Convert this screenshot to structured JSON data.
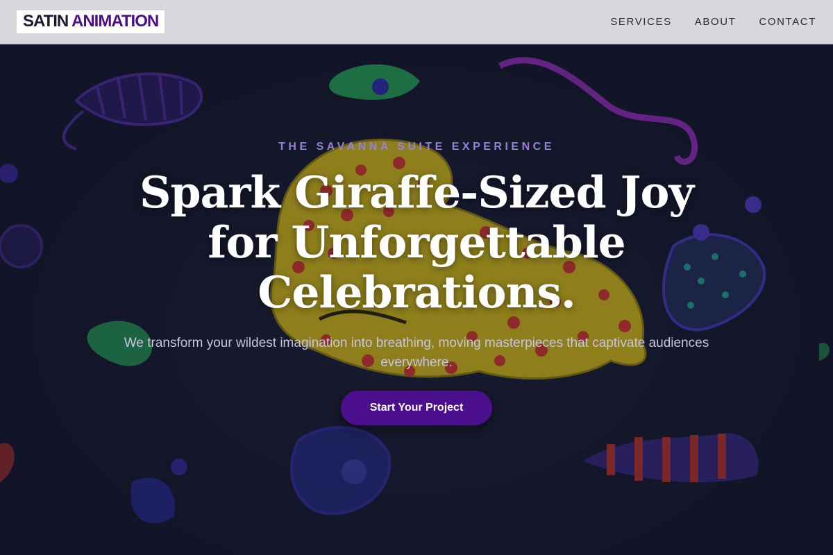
{
  "header": {
    "logo_word_1": "SATIN",
    "logo_word_2": "ANIMATION",
    "nav": [
      "SERVICES",
      "ABOUT",
      "CONTACT"
    ]
  },
  "hero": {
    "eyebrow": "THE SAVANNA SUITE EXPERIENCE",
    "headline": "Spark Giraffe-Sized Joy for Unforgettable Celebrations.",
    "subheadline": "We transform your wildest imagination into breathing, moving masterpieces that captivate audiences everywhere.",
    "cta_label": "Start Your Project"
  },
  "colors": {
    "brand_purple": "#4b0e8c",
    "eyebrow_purple": "#9a7fd6",
    "header_bg": "#d8d8dc",
    "hero_bg": "#14162a"
  }
}
